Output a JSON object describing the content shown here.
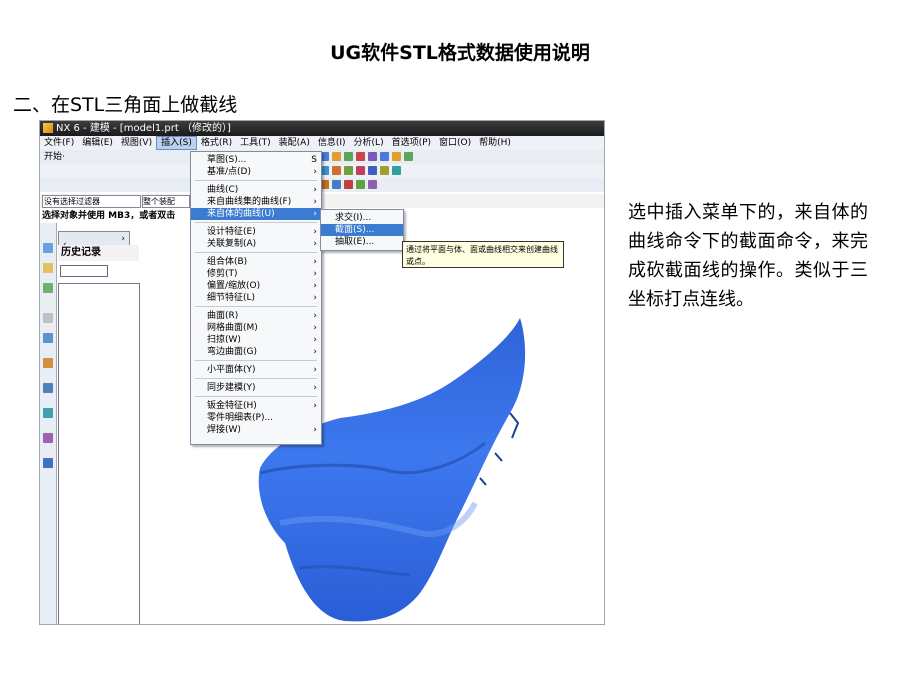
{
  "slide": {
    "title": "UG软件STL格式数据使用说明",
    "heading": "二、在STL三角面上做截线",
    "description": "选中插入菜单下的，来自体的曲线命令下的截面命令，来完成砍截面线的操作。类似于三坐标打点连线。"
  },
  "app": {
    "window_title": "NX 6 - 建模 - [model1.prt （修改的）]",
    "menu": [
      "文件(F)",
      "编辑(E)",
      "视图(V)",
      "插入(S)",
      "格式(R)",
      "工具(T)",
      "装配(A)",
      "信息(I)",
      "分析(L)",
      "首选项(P)",
      "窗口(O)",
      "帮助(H)"
    ],
    "toolbar_start": "开始·",
    "filter": "没有选择过滤器",
    "filter2": "整个装配",
    "prompt": "选择对象并使用 MB3，或者双击",
    "history_tab": "历史记录",
    "insert_menu": [
      {
        "label": "草图(S)...",
        "shortcut": "S"
      },
      {
        "label": "基准/点(D)",
        "arrow": "›"
      },
      {
        "label": "曲线(C)",
        "arrow": "›"
      },
      {
        "label": "来自曲线集的曲线(F)",
        "arrow": "›"
      },
      {
        "label": "来自体的曲线(U)",
        "arrow": "›"
      },
      {
        "label": "设计特征(E)",
        "arrow": "›"
      },
      {
        "label": "关联复制(A)",
        "arrow": "›"
      },
      {
        "label": "组合体(B)",
        "arrow": "›"
      },
      {
        "label": "修剪(T)",
        "arrow": "›"
      },
      {
        "label": "偏置/缩放(O)",
        "arrow": "›"
      },
      {
        "label": "细节特征(L)",
        "arrow": "›"
      },
      {
        "label": "曲面(R)",
        "arrow": "›"
      },
      {
        "label": "网格曲面(M)",
        "arrow": "›"
      },
      {
        "label": "扫掠(W)",
        "arrow": "›"
      },
      {
        "label": "弯边曲面(G)",
        "arrow": "›"
      },
      {
        "label": "小平面体(Y)",
        "arrow": "›"
      },
      {
        "label": "同步建模(Y)",
        "arrow": "›"
      },
      {
        "label": "钣金特征(H)",
        "arrow": "›"
      },
      {
        "label": "零件明细表(P)...",
        "arrow": ""
      },
      {
        "label": "焊接(W)",
        "arrow": "›"
      }
    ],
    "submenu": [
      "求交(I)...",
      "截面(S)...",
      "抽取(E)..."
    ],
    "tooltip": "通过将平面与体、面或曲线相交来创建曲线或点。",
    "accent": "#3b7bd1",
    "mesh_color": "#3a6fe0"
  }
}
